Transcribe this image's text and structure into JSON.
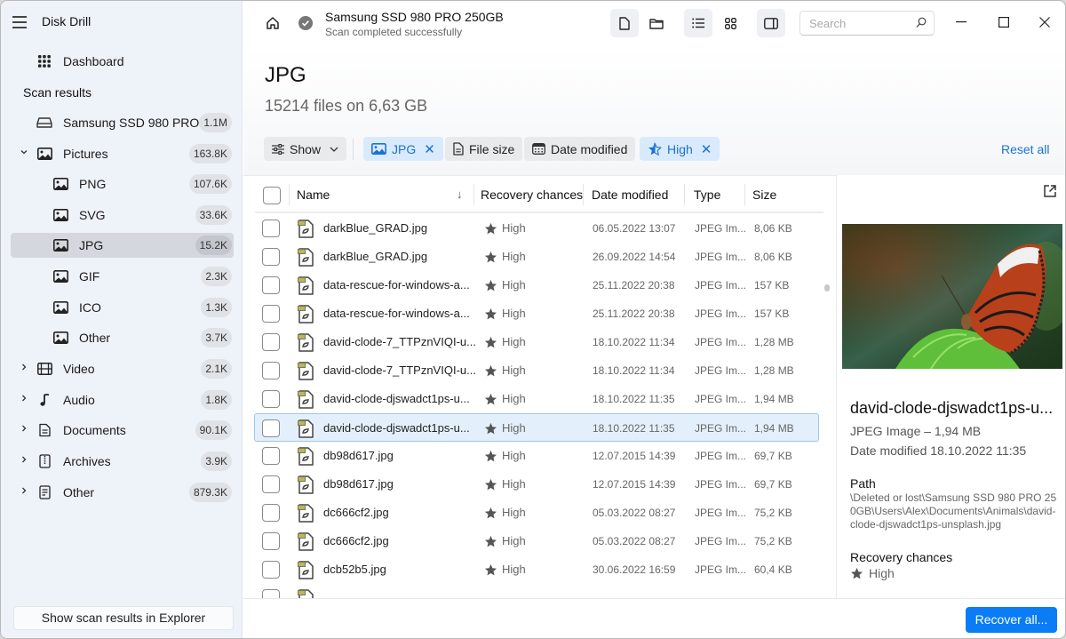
{
  "app": {
    "title": "Disk Drill"
  },
  "sidebar": {
    "dashboard_label": "Dashboard",
    "section_label": "Scan results",
    "items": [
      {
        "label": "Samsung SSD 980 PRO...",
        "count": "1.1M",
        "icon": "drive-icon",
        "level": 0,
        "expander": "none"
      },
      {
        "label": "Pictures",
        "count": "163.8K",
        "icon": "picture-icon",
        "level": 0,
        "expander": "expanded"
      },
      {
        "label": "PNG",
        "count": "107.6K",
        "icon": "picture-icon",
        "level": 1,
        "expander": "none"
      },
      {
        "label": "SVG",
        "count": "33.6K",
        "icon": "picture-icon",
        "level": 1,
        "expander": "none"
      },
      {
        "label": "JPG",
        "count": "15.2K",
        "icon": "picture-icon",
        "level": 1,
        "expander": "none",
        "active": true
      },
      {
        "label": "GIF",
        "count": "2.3K",
        "icon": "picture-icon",
        "level": 1,
        "expander": "none"
      },
      {
        "label": "ICO",
        "count": "1.3K",
        "icon": "picture-icon",
        "level": 1,
        "expander": "none"
      },
      {
        "label": "Other",
        "count": "3.7K",
        "icon": "picture-icon",
        "level": 1,
        "expander": "none"
      },
      {
        "label": "Video",
        "count": "2.1K",
        "icon": "film-icon",
        "level": 0,
        "expander": "collapsed"
      },
      {
        "label": "Audio",
        "count": "1.8K",
        "icon": "music-note-icon",
        "level": 0,
        "expander": "collapsed"
      },
      {
        "label": "Documents",
        "count": "90.1K",
        "icon": "document-icon",
        "level": 0,
        "expander": "collapsed"
      },
      {
        "label": "Archives",
        "count": "3.9K",
        "icon": "archive-icon",
        "level": 0,
        "expander": "collapsed"
      },
      {
        "label": "Other",
        "count": "879.3K",
        "icon": "other-file-icon",
        "level": 0,
        "expander": "collapsed"
      }
    ],
    "footer_button": "Show scan results in Explorer"
  },
  "topbar": {
    "device_name": "Samsung SSD 980 PRO 250GB",
    "status": "Scan completed successfully",
    "search_placeholder": "Search"
  },
  "main": {
    "title": "JPG",
    "subtitle": "15214 files on 6,63 GB",
    "filters": {
      "show_label": "Show",
      "chips": [
        {
          "label": "JPG",
          "selected": true,
          "removable": true
        },
        {
          "label": "File size",
          "selected": false,
          "removable": false
        },
        {
          "label": "Date modified",
          "selected": false,
          "removable": false
        },
        {
          "label": "High",
          "selected": true,
          "removable": true
        }
      ],
      "reset_label": "Reset all"
    },
    "table": {
      "columns": [
        "Name",
        "Recovery chances",
        "Date modified",
        "Type",
        "Size"
      ],
      "sort_column": "Name",
      "sort_direction": "descending",
      "rows": [
        {
          "name": "darkBlue_GRAD.jpg",
          "recovery": "High",
          "date": "06.05.2022 13:07",
          "type": "JPEG Im...",
          "size": "8,06 KB"
        },
        {
          "name": "darkBlue_GRAD.jpg",
          "recovery": "High",
          "date": "26.09.2022 14:54",
          "type": "JPEG Im...",
          "size": "8,06 KB"
        },
        {
          "name": "data-rescue-for-windows-a...",
          "recovery": "High",
          "date": "25.11.2022 20:38",
          "type": "JPEG Im...",
          "size": "157 KB"
        },
        {
          "name": "data-rescue-for-windows-a...",
          "recovery": "High",
          "date": "25.11.2022 20:38",
          "type": "JPEG Im...",
          "size": "157 KB"
        },
        {
          "name": "david-clode-7_TTPznVIQI-u...",
          "recovery": "High",
          "date": "18.10.2022 11:34",
          "type": "JPEG Im...",
          "size": "1,28 MB"
        },
        {
          "name": "david-clode-7_TTPznVIQI-u...",
          "recovery": "High",
          "date": "18.10.2022 11:34",
          "type": "JPEG Im...",
          "size": "1,28 MB"
        },
        {
          "name": "david-clode-djswadct1ps-u...",
          "recovery": "High",
          "date": "18.10.2022 11:35",
          "type": "JPEG Im...",
          "size": "1,94 MB"
        },
        {
          "name": "david-clode-djswadct1ps-u...",
          "recovery": "High",
          "date": "18.10.2022 11:35",
          "type": "JPEG Im...",
          "size": "1,94 MB",
          "selected": true
        },
        {
          "name": "db98d617.jpg",
          "recovery": "High",
          "date": "12.07.2015 14:39",
          "type": "JPEG Im...",
          "size": "69,7 KB"
        },
        {
          "name": "db98d617.jpg",
          "recovery": "High",
          "date": "12.07.2015 14:39",
          "type": "JPEG Im...",
          "size": "69,7 KB"
        },
        {
          "name": "dc666cf2.jpg",
          "recovery": "High",
          "date": "05.03.2022 08:27",
          "type": "JPEG Im...",
          "size": "75,2 KB"
        },
        {
          "name": "dc666cf2.jpg",
          "recovery": "High",
          "date": "05.03.2022 08:27",
          "type": "JPEG Im...",
          "size": "75,2 KB"
        },
        {
          "name": "dcb52b5.jpg",
          "recovery": "High",
          "date": "30.06.2022 16:59",
          "type": "JPEG Im...",
          "size": "60,4 KB"
        }
      ]
    }
  },
  "preview": {
    "file_name": "david-clode-djswadct1ps-u...",
    "type_size": "JPEG Image – 1,94 MB",
    "date_modified": "Date modified 18.10.2022 11:35",
    "path_label": "Path",
    "path": "\\Deleted or lost\\Samsung SSD 980 PRO 250GB\\Users\\Alex\\Documents\\Animals\\david-clode-djswadct1ps-unsplash.jpg",
    "recovery_label": "Recovery chances",
    "recovery_value": "High"
  },
  "footer": {
    "recover_button": "Recover all..."
  },
  "colors": {
    "accent": "#0a7cf5",
    "link": "#1b73d1",
    "chip_selected_bg": "#d9eafc",
    "sidebar_bg": "#eef2f9"
  }
}
